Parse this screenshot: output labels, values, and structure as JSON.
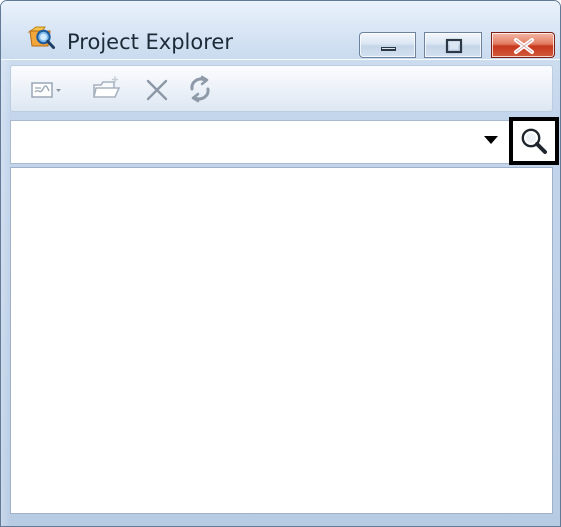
{
  "window": {
    "title": "Project Explorer",
    "accent": "#c9dbef",
    "close_button_color": "#d35a3d"
  },
  "titlebar_buttons": {
    "minimize_icon": "minimize-icon",
    "restore_icon": "restore-icon",
    "close_icon": "close-icon"
  },
  "toolbar": {
    "items": [
      {
        "icon": "list-view-icon"
      },
      {
        "icon": "folder-icon"
      },
      {
        "icon": "delete-icon"
      },
      {
        "icon": "refresh-icon"
      }
    ]
  },
  "search": {
    "value": "",
    "placeholder": "",
    "dropdown_icon": "dropdown-arrow-icon",
    "button_icon": "search-icon"
  },
  "main": {
    "items": []
  }
}
